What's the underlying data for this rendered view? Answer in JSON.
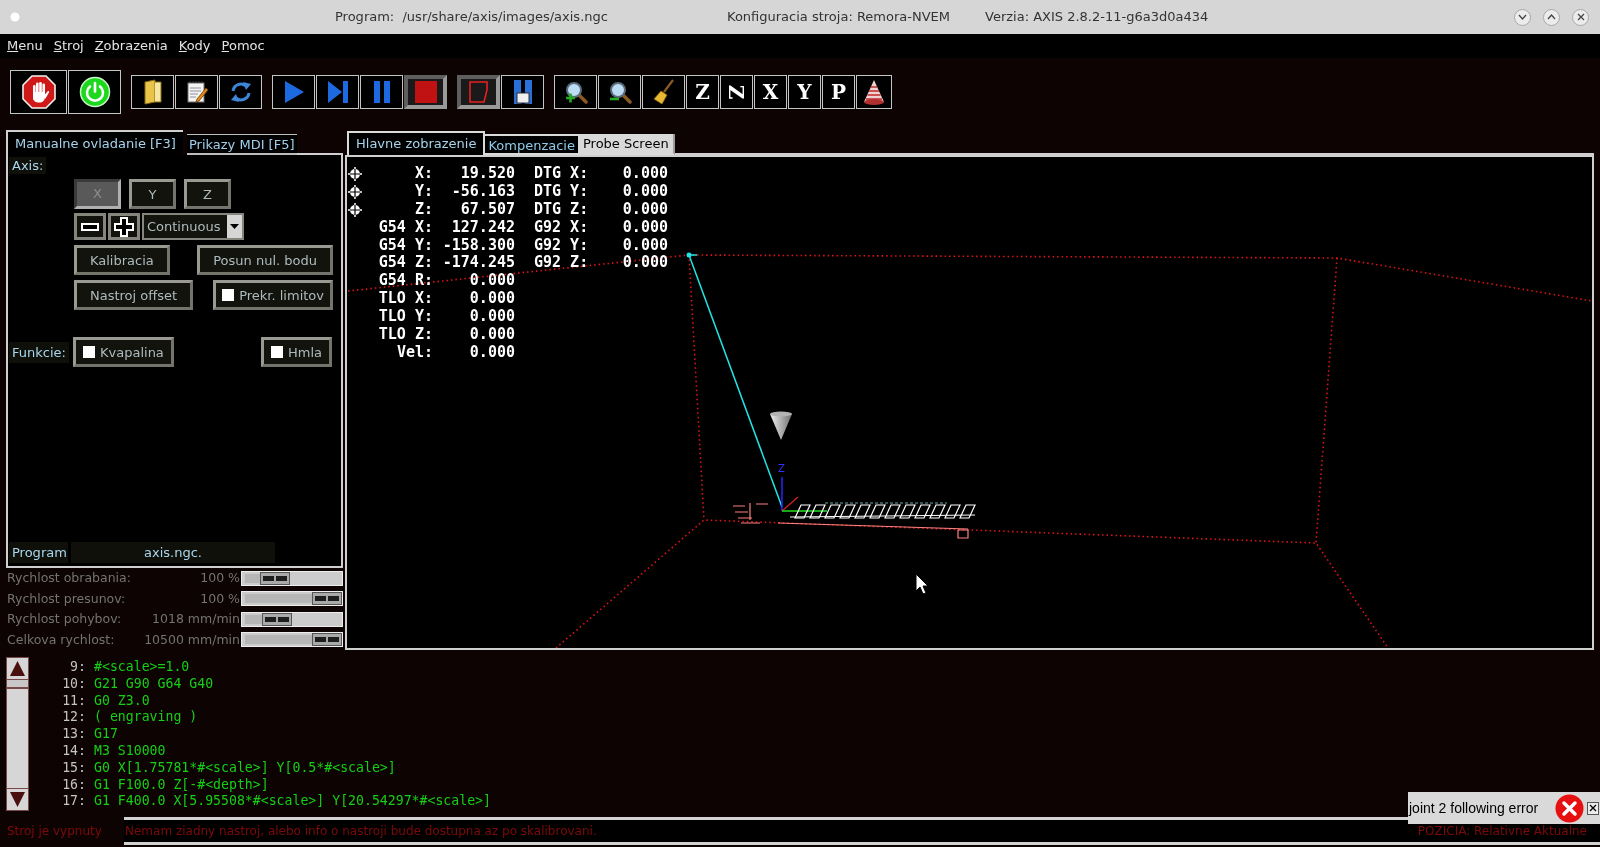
{
  "window": {
    "title": [
      "Program:  /usr/share/axis/images/axis.ngc",
      "Konfiguracia stroja: Remora-NVEM",
      "Verzia: AXIS 2.8.2-11-g6a3d0a434"
    ]
  },
  "menu": [
    "Menu",
    "Stroj",
    "Zobrazenia",
    "Kody",
    "Pomoc"
  ],
  "toolbar": [
    [
      {
        "kind": "estop",
        "pressed": false
      },
      {
        "kind": "power",
        "pressed": false
      }
    ],
    [
      {
        "kind": "open",
        "pressed": false
      },
      {
        "kind": "edit",
        "pressed": false
      },
      {
        "kind": "reload",
        "pressed": false
      }
    ],
    [
      {
        "kind": "run",
        "pressed": false
      },
      {
        "kind": "step",
        "pressed": false
      },
      {
        "kind": "pause",
        "pressed": false
      },
      {
        "kind": "stop",
        "pressed": true
      }
    ],
    [
      {
        "kind": "block_delete",
        "pressed": true
      },
      {
        "kind": "optional_stop",
        "pressed": false
      }
    ],
    [
      {
        "kind": "zoom_in",
        "pressed": false
      },
      {
        "kind": "zoom_out",
        "pressed": false
      },
      {
        "kind": "clear",
        "pressed": false
      },
      {
        "kind": "view",
        "label": "Z",
        "pressed": false
      },
      {
        "kind": "view_rotated",
        "label": "Z",
        "pressed": false
      },
      {
        "kind": "view",
        "label": "X",
        "pressed": false
      },
      {
        "kind": "view",
        "label": "Y",
        "pressed": false
      },
      {
        "kind": "view",
        "label": "P",
        "pressed": false
      },
      {
        "kind": "tool",
        "pressed": false
      }
    ]
  ],
  "manual": {
    "tabs": [
      {
        "label": "Manualne ovladanie [F3]",
        "selected": true
      },
      {
        "label": "Prikazy MDI [F5]",
        "selected": false
      }
    ],
    "axis_label": "Axis:",
    "axes": [
      {
        "label": "X",
        "selected": true
      },
      {
        "label": "Y",
        "selected": false
      },
      {
        "label": "Z",
        "selected": false
      }
    ],
    "jog_mode": "Continuous",
    "rows": [
      [
        {
          "kind": "button",
          "label": "Kalibracia"
        },
        {
          "kind": "button",
          "label": "Posun nul. bodu"
        }
      ],
      [
        {
          "kind": "button",
          "label": "Nastroj offset"
        },
        {
          "kind": "checkbox",
          "label": "Prekr. limitov",
          "checked": false
        }
      ]
    ],
    "functions_label": "Funkcie:",
    "functions": [
      {
        "label": "Kvapalina",
        "checked": false
      },
      {
        "label": "Hmla",
        "checked": false
      }
    ],
    "program_label": "Program",
    "program_file": "axis.ngc."
  },
  "overrides": [
    {
      "label": "Rychlost obrabania:",
      "value": "100 %",
      "level": 0.25
    },
    {
      "label": "Rychlost presunov:",
      "value": "100 %",
      "level": 1
    },
    {
      "label": "Rychlost pohybov:",
      "value": "1018 mm/min",
      "level": 0.29
    },
    {
      "label": "Celkova rychlost:",
      "value": "10500 mm/min",
      "level": 1
    }
  ],
  "view_tabs": [
    {
      "label": "Hlavne zobrazenie",
      "selected": true,
      "kind": "themed"
    },
    {
      "label": "Kompenzacie",
      "selected": false,
      "kind": "themed"
    },
    {
      "label": "Probe Screen",
      "selected": false,
      "kind": "plain"
    }
  ],
  "dro": [
    {
      "homed": true,
      "label": "X:",
      "value": "19.520",
      "label2": "DTG X:",
      "value2": "0.000"
    },
    {
      "homed": true,
      "label": "Y:",
      "value": "-56.163",
      "label2": "DTG Y:",
      "value2": "0.000"
    },
    {
      "homed": true,
      "label": "Z:",
      "value": "67.507",
      "label2": "DTG Z:",
      "value2": "0.000"
    },
    {
      "homed": false,
      "label": "G54 X:",
      "value": "127.242",
      "label2": "G92 X:",
      "value2": "0.000"
    },
    {
      "homed": false,
      "label": "G54 Y:",
      "value": "-158.300",
      "label2": "G92 Y:",
      "value2": "0.000"
    },
    {
      "homed": false,
      "label": "G54 Z:",
      "value": "-174.245",
      "label2": "G92 Z:",
      "value2": "0.000"
    },
    {
      "homed": false,
      "label": "G54 R:",
      "value": "0.000"
    },
    {
      "homed": false,
      "label": "TLO X:",
      "value": "0.000"
    },
    {
      "homed": false,
      "label": "TLO Y:",
      "value": "0.000"
    },
    {
      "homed": false,
      "label": "TLO Z:",
      "value": "0.000"
    },
    {
      "homed": false,
      "label": "Vel:",
      "value": "0.000"
    }
  ],
  "plot": {
    "axis_label": "Z"
  },
  "code": [
    {
      "number": "9:",
      "text": "#<scale>=1.0"
    },
    {
      "number": "10:",
      "text": "G21 G90 G64 G40"
    },
    {
      "number": "11:",
      "text": "G0 Z3.0"
    },
    {
      "number": "12:",
      "text": "( engraving )"
    },
    {
      "number": "13:",
      "text": "G17"
    },
    {
      "number": "14:",
      "text": "M3 S10000"
    },
    {
      "number": "15:",
      "text": "G0 X[1.75781*#<scale>] Y[0.5*#<scale>]"
    },
    {
      "number": "16:",
      "text": "G1 F100.0 Z[-#<depth>]"
    },
    {
      "number": "17:",
      "text": "G1 F400.0 X[5.95508*#<scale>] Y[20.54297*#<scale>]"
    }
  ],
  "status": {
    "machine": "Stroj je vypnuty",
    "message": "Nemam ziadny nastroj, alebo info o nastroji bude dostupna az po skalibrovani.",
    "position": "POZICIA: Relativne Aktualne"
  },
  "notification": {
    "text": "joint 2 following error"
  }
}
